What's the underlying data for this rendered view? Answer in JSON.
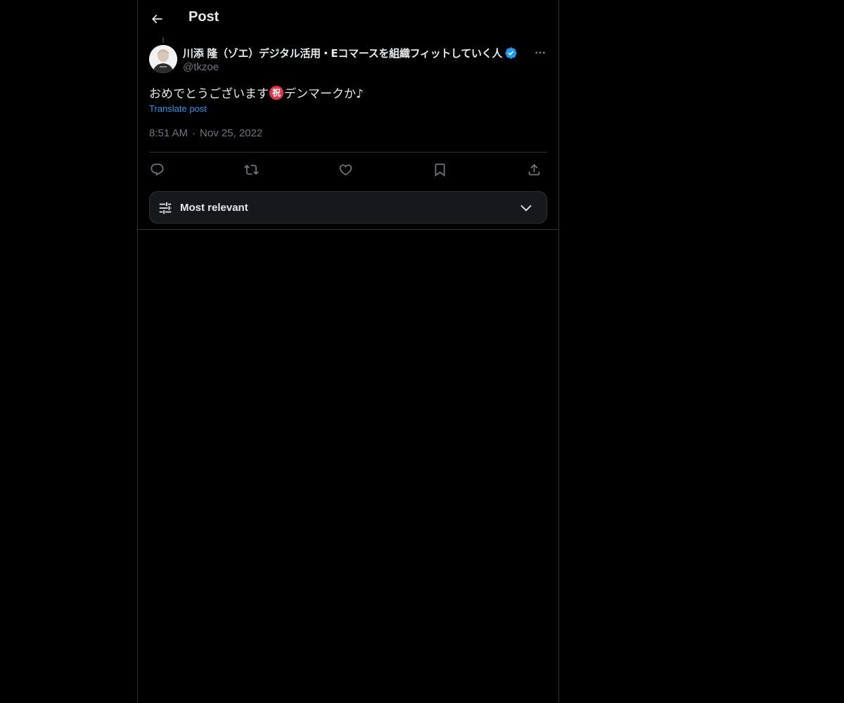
{
  "header": {
    "title": "Post",
    "back_icon": "arrow-left-icon"
  },
  "post": {
    "author": {
      "display_name": "川添 隆（ゾエ）デジタル活用・Eコマースを組織フィットしていく人",
      "handle": "@tkzoe",
      "verified": true,
      "verified_color": "#1d9bf0"
    },
    "text_before_emoji": "おめでとうございます",
    "emoji_char": "祝",
    "text_after_emoji": "デンマークか♪",
    "translate_label": "Translate post",
    "time": "8:51 AM",
    "separator": "·",
    "date": "Nov 25, 2022"
  },
  "actions": [
    {
      "name": "reply",
      "icon": "reply-icon"
    },
    {
      "name": "repost",
      "icon": "repost-icon"
    },
    {
      "name": "like",
      "icon": "heart-icon"
    },
    {
      "name": "bookmark",
      "icon": "bookmark-icon"
    },
    {
      "name": "share",
      "icon": "share-icon"
    }
  ],
  "replies_sort": {
    "label": "Most relevant",
    "icon": "sliders-icon",
    "dropdown_icon": "chevron-down-icon"
  },
  "colors": {
    "background": "#000000",
    "text_primary": "#e7e9ea",
    "text_secondary": "#71767b",
    "accent": "#1d9bf0",
    "border": "#2f3336"
  }
}
